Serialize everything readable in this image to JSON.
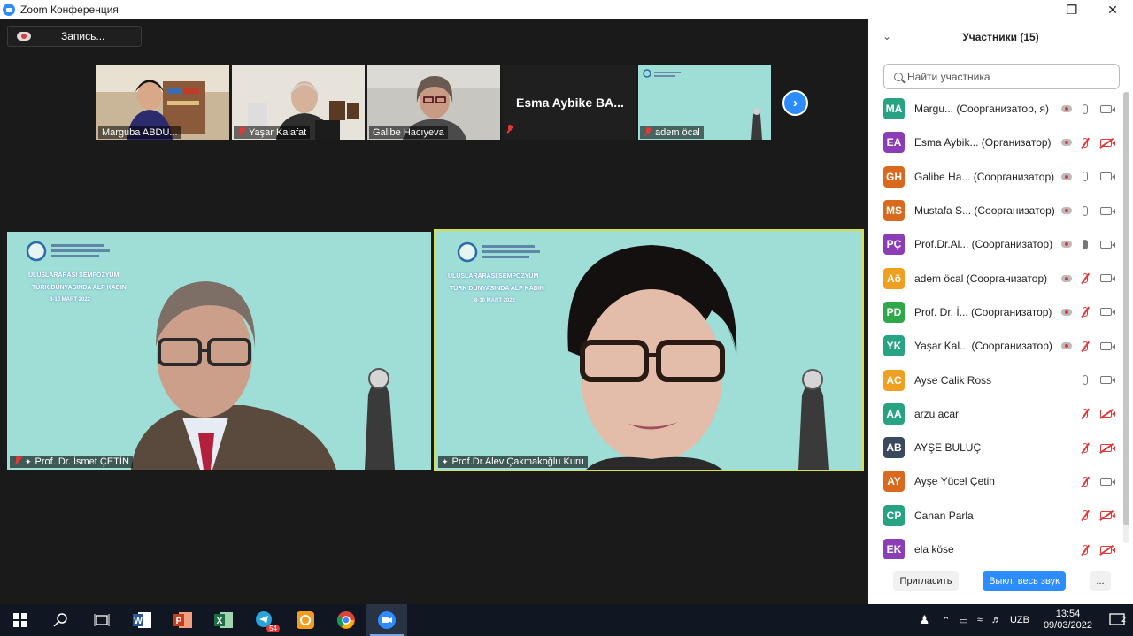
{
  "window": {
    "title": "Zoom Конференция"
  },
  "recording": {
    "label": "Запись..."
  },
  "thumbnails": [
    {
      "name": "Marguba ABDU...",
      "muted": false
    },
    {
      "name": "Yaşar Kalafat",
      "muted": true
    },
    {
      "name": "Galibe Hacıyeva",
      "muted": false
    },
    {
      "name": "Esma Aybike BA...",
      "muted": true
    },
    {
      "name": "adem öcal",
      "muted": true
    }
  ],
  "videos": [
    {
      "name": "Prof. Dr. İsmet ÇETİN",
      "muted": true,
      "active_speaker": false
    },
    {
      "name": "Prof.Dr.Alev Çakmakoğlu Kuru",
      "muted": false,
      "active_speaker": true
    }
  ],
  "background_banner": {
    "line1": "ULUSLARARASI SEMPOZYUM",
    "line2": "TÜRK DÜNYASINDA ALP KADIN",
    "line3": "8-10 MART 2022"
  },
  "participants_panel": {
    "title": "Участники (15)",
    "search_placeholder": "Найти участника",
    "participants": [
      {
        "initials": "MA",
        "color": "#27a384",
        "name": "Margu... (Соорганизатор, я)",
        "rec": true,
        "mic": "on",
        "cam": "on"
      },
      {
        "initials": "EA",
        "color": "#8a3db6",
        "name": "Esma Aybik... (Организатор)",
        "rec": true,
        "mic": "off",
        "cam": "off"
      },
      {
        "initials": "GH",
        "color": "#d9691c",
        "name": "Galibe Ha... (Соорганизатор)",
        "rec": true,
        "mic": "on",
        "cam": "on"
      },
      {
        "initials": "MS",
        "color": "#d9691c",
        "name": "Mustafa S... (Соорганизатор)",
        "rec": true,
        "mic": "on",
        "cam": "on"
      },
      {
        "initials": "PÇ",
        "color": "#8a3db6",
        "name": "Prof.Dr.Al... (Соорганизатор)",
        "rec": true,
        "mic": "speaking",
        "cam": "on"
      },
      {
        "initials": "Aö",
        "color": "#f0a020",
        "name": "adem öcal (Соорганизатор)",
        "rec": true,
        "mic": "off",
        "cam": "on"
      },
      {
        "initials": "PD",
        "color": "#2ea84a",
        "name": "Prof. Dr. İ... (Соорганизатор)",
        "rec": true,
        "mic": "off",
        "cam": "on"
      },
      {
        "initials": "YK",
        "color": "#27a384",
        "name": "Yaşar Kal... (Соорганизатор)",
        "rec": true,
        "mic": "off",
        "cam": "on"
      },
      {
        "initials": "AC",
        "color": "#f0a020",
        "name": "Ayse Calik Ross",
        "rec": false,
        "mic": "on",
        "cam": "on"
      },
      {
        "initials": "AA",
        "color": "#27a384",
        "name": "arzu acar",
        "rec": false,
        "mic": "off",
        "cam": "off"
      },
      {
        "initials": "AB",
        "color": "#3a4a5c",
        "name": "AYŞE BULUÇ",
        "rec": false,
        "mic": "off",
        "cam": "off"
      },
      {
        "initials": "AY",
        "color": "#d9691c",
        "name": "Ayşe Yücel Çetin",
        "rec": false,
        "mic": "off",
        "cam": "on"
      },
      {
        "initials": "CP",
        "color": "#27a384",
        "name": "Canan Parla",
        "rec": false,
        "mic": "off",
        "cam": "off"
      },
      {
        "initials": "EK",
        "color": "#8a3db6",
        "name": "ela köse",
        "rec": false,
        "mic": "off",
        "cam": "off"
      }
    ],
    "invite_label": "Пригласить",
    "mute_all_label": "Выкл. весь звук",
    "more_label": "..."
  },
  "taskbar": {
    "telegram_badge": "54",
    "tray_lang": "UZB",
    "time": "13:54",
    "date": "09/03/2022",
    "notifications": "2"
  }
}
